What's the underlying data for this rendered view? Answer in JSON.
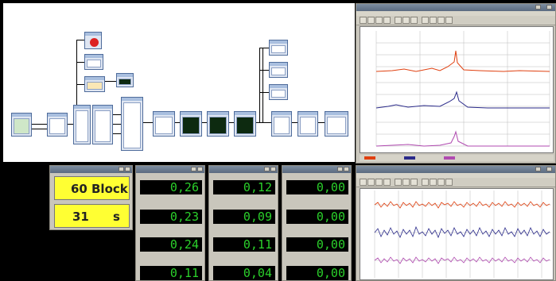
{
  "colors": {
    "counter_bg": "#ffff33",
    "digital_text": "#2bd02b",
    "trace_red": "#e04010",
    "trace_blue": "#2a2a8a",
    "trace_purple": "#b04ab0"
  },
  "counter": {
    "value1": "60",
    "unit1": "Block",
    "value2": "31",
    "unit2": "s"
  },
  "digital_panels": [
    {
      "values": [
        "0,26",
        "0,23",
        "0,24",
        "0,11"
      ]
    },
    {
      "values": [
        "0,12",
        "0,09",
        "0,11",
        "0,04"
      ]
    },
    {
      "values": [
        "0,00",
        "0,00",
        "0,00",
        "0,00"
      ]
    }
  ],
  "icons": [
    "stop-icon",
    "close-icon",
    "minimize-icon",
    "maximize-icon"
  ]
}
